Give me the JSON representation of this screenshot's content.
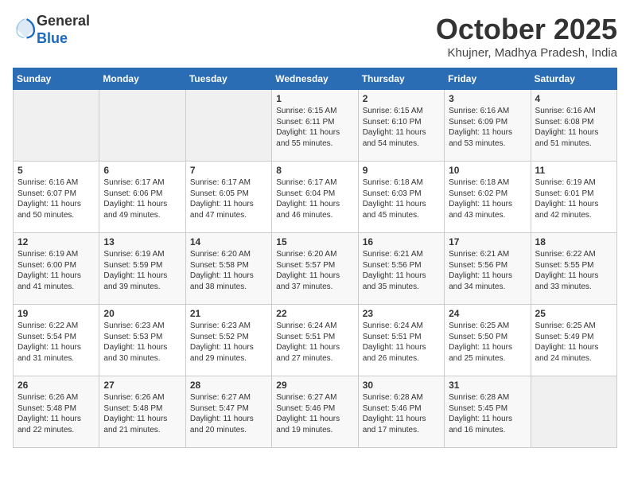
{
  "header": {
    "logo_line1": "General",
    "logo_line2": "Blue",
    "month": "October 2025",
    "location": "Khujner, Madhya Pradesh, India"
  },
  "weekdays": [
    "Sunday",
    "Monday",
    "Tuesday",
    "Wednesday",
    "Thursday",
    "Friday",
    "Saturday"
  ],
  "weeks": [
    [
      {
        "day": "",
        "content": ""
      },
      {
        "day": "",
        "content": ""
      },
      {
        "day": "",
        "content": ""
      },
      {
        "day": "1",
        "content": "Sunrise: 6:15 AM\nSunset: 6:11 PM\nDaylight: 11 hours\nand 55 minutes."
      },
      {
        "day": "2",
        "content": "Sunrise: 6:15 AM\nSunset: 6:10 PM\nDaylight: 11 hours\nand 54 minutes."
      },
      {
        "day": "3",
        "content": "Sunrise: 6:16 AM\nSunset: 6:09 PM\nDaylight: 11 hours\nand 53 minutes."
      },
      {
        "day": "4",
        "content": "Sunrise: 6:16 AM\nSunset: 6:08 PM\nDaylight: 11 hours\nand 51 minutes."
      }
    ],
    [
      {
        "day": "5",
        "content": "Sunrise: 6:16 AM\nSunset: 6:07 PM\nDaylight: 11 hours\nand 50 minutes."
      },
      {
        "day": "6",
        "content": "Sunrise: 6:17 AM\nSunset: 6:06 PM\nDaylight: 11 hours\nand 49 minutes."
      },
      {
        "day": "7",
        "content": "Sunrise: 6:17 AM\nSunset: 6:05 PM\nDaylight: 11 hours\nand 47 minutes."
      },
      {
        "day": "8",
        "content": "Sunrise: 6:17 AM\nSunset: 6:04 PM\nDaylight: 11 hours\nand 46 minutes."
      },
      {
        "day": "9",
        "content": "Sunrise: 6:18 AM\nSunset: 6:03 PM\nDaylight: 11 hours\nand 45 minutes."
      },
      {
        "day": "10",
        "content": "Sunrise: 6:18 AM\nSunset: 6:02 PM\nDaylight: 11 hours\nand 43 minutes."
      },
      {
        "day": "11",
        "content": "Sunrise: 6:19 AM\nSunset: 6:01 PM\nDaylight: 11 hours\nand 42 minutes."
      }
    ],
    [
      {
        "day": "12",
        "content": "Sunrise: 6:19 AM\nSunset: 6:00 PM\nDaylight: 11 hours\nand 41 minutes."
      },
      {
        "day": "13",
        "content": "Sunrise: 6:19 AM\nSunset: 5:59 PM\nDaylight: 11 hours\nand 39 minutes."
      },
      {
        "day": "14",
        "content": "Sunrise: 6:20 AM\nSunset: 5:58 PM\nDaylight: 11 hours\nand 38 minutes."
      },
      {
        "day": "15",
        "content": "Sunrise: 6:20 AM\nSunset: 5:57 PM\nDaylight: 11 hours\nand 37 minutes."
      },
      {
        "day": "16",
        "content": "Sunrise: 6:21 AM\nSunset: 5:56 PM\nDaylight: 11 hours\nand 35 minutes."
      },
      {
        "day": "17",
        "content": "Sunrise: 6:21 AM\nSunset: 5:56 PM\nDaylight: 11 hours\nand 34 minutes."
      },
      {
        "day": "18",
        "content": "Sunrise: 6:22 AM\nSunset: 5:55 PM\nDaylight: 11 hours\nand 33 minutes."
      }
    ],
    [
      {
        "day": "19",
        "content": "Sunrise: 6:22 AM\nSunset: 5:54 PM\nDaylight: 11 hours\nand 31 minutes."
      },
      {
        "day": "20",
        "content": "Sunrise: 6:23 AM\nSunset: 5:53 PM\nDaylight: 11 hours\nand 30 minutes."
      },
      {
        "day": "21",
        "content": "Sunrise: 6:23 AM\nSunset: 5:52 PM\nDaylight: 11 hours\nand 29 minutes."
      },
      {
        "day": "22",
        "content": "Sunrise: 6:24 AM\nSunset: 5:51 PM\nDaylight: 11 hours\nand 27 minutes."
      },
      {
        "day": "23",
        "content": "Sunrise: 6:24 AM\nSunset: 5:51 PM\nDaylight: 11 hours\nand 26 minutes."
      },
      {
        "day": "24",
        "content": "Sunrise: 6:25 AM\nSunset: 5:50 PM\nDaylight: 11 hours\nand 25 minutes."
      },
      {
        "day": "25",
        "content": "Sunrise: 6:25 AM\nSunset: 5:49 PM\nDaylight: 11 hours\nand 24 minutes."
      }
    ],
    [
      {
        "day": "26",
        "content": "Sunrise: 6:26 AM\nSunset: 5:48 PM\nDaylight: 11 hours\nand 22 minutes."
      },
      {
        "day": "27",
        "content": "Sunrise: 6:26 AM\nSunset: 5:48 PM\nDaylight: 11 hours\nand 21 minutes."
      },
      {
        "day": "28",
        "content": "Sunrise: 6:27 AM\nSunset: 5:47 PM\nDaylight: 11 hours\nand 20 minutes."
      },
      {
        "day": "29",
        "content": "Sunrise: 6:27 AM\nSunset: 5:46 PM\nDaylight: 11 hours\nand 19 minutes."
      },
      {
        "day": "30",
        "content": "Sunrise: 6:28 AM\nSunset: 5:46 PM\nDaylight: 11 hours\nand 17 minutes."
      },
      {
        "day": "31",
        "content": "Sunrise: 6:28 AM\nSunset: 5:45 PM\nDaylight: 11 hours\nand 16 minutes."
      },
      {
        "day": "",
        "content": ""
      }
    ]
  ]
}
